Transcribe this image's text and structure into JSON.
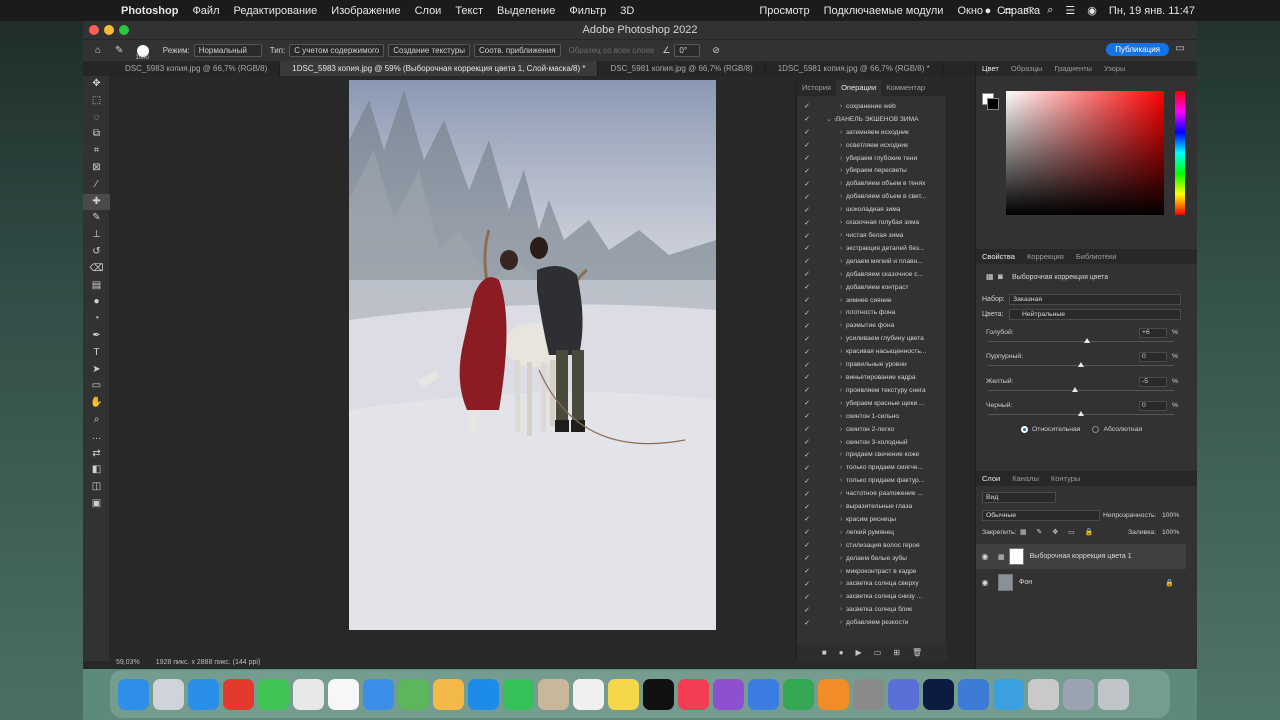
{
  "menubar": {
    "app": "Photoshop",
    "items": [
      "Файл",
      "Редактирование",
      "Изображение",
      "Слои",
      "Текст",
      "Выделение",
      "Фильтр",
      "3D",
      "Просмотр",
      "Подключаемые модули",
      "Окно",
      "Справка"
    ],
    "clock": "Пн, 19 янв. 11:47"
  },
  "window": {
    "title": "Adobe Photoshop 2022"
  },
  "options": {
    "brush_size": "1000",
    "mode_label": "Режим:",
    "mode_value": "Нормальный",
    "type_label": "Тип:",
    "type_btn1": "С учетом содержимого",
    "type_btn2": "Создание текстуры",
    "type_btn3": "Соотв. приближения",
    "sample_all": "Образец со всех слоев",
    "angle": "0°",
    "publish": "Публикация"
  },
  "tabs": [
    "DSC_5983 копия.jpg @ 66,7% (RGB/8)",
    "1DSC_5983 копия.jpg @ 59% (Выборочная коррекция цвета 1, Слой-маска/8) *",
    "DSC_5981 копия.jpg @ 66,7% (RGB/8)",
    "1DSC_5981 копия.jpg @ 66,7% (RGB/8) *"
  ],
  "status": {
    "zoom": "59,03%",
    "size": "1928 пикс. x 2888 пикс. (144 ppi)"
  },
  "ops_panel": {
    "tabs": [
      "История",
      "Операции",
      "Комментар"
    ],
    "items": [
      "сохранение web",
      "ПАНЕЛЬ ЭКШЕНОВ ЗИМА",
      "затемняем исходник",
      "осветляем исходник",
      "убираем глубокие тени",
      "убираем пересветы",
      "добавляем объем в тенях",
      "добавляем объем в свет...",
      "шоколадная зима",
      "сказочная голубая зима",
      "чистая белая зима",
      "экстракция деталей без...",
      "делаем мягкий и плавн...",
      "добавляем сказочное с...",
      "добавляем контраст",
      "зимнее сияние",
      "плотность фона",
      "размытие фона",
      "усиливаем глубину цвета",
      "красивая насыщенность...",
      "правильные уровни",
      "виньетирование кадра",
      "проявляем текстуру снега",
      "убираем красные щеки ...",
      "скинтон 1-сильно",
      "скинтон 2-легко",
      "скинтон 3-холодный",
      "придаем свечение коже",
      "только придаем смягче...",
      "только придаем фактур...",
      "частотное разложение ...",
      "выразительные глаза",
      "красим ресницы",
      "легкий румянец",
      "стилизация волос героя",
      "делаем белые зубы",
      "микроконтраст в кадре",
      "засветка солнца сверху",
      "засветка солнца снизу ...",
      "засветка солнца блик",
      "добавляем резкости"
    ]
  },
  "color_panel": {
    "tabs": [
      "Цвет",
      "Образцы",
      "Градиенты",
      "Узоры"
    ]
  },
  "properties": {
    "tabs": [
      "Свойства",
      "Коррекция",
      "Библиотеки"
    ],
    "title": "Выборочная коррекция цвета",
    "preset_label": "Набор:",
    "preset_value": "Заказная",
    "colors_label": "Цвета:",
    "colors_value": "Нейтральные",
    "sliders": [
      {
        "label": "Голубой:",
        "value": "+6",
        "pos": 0.53
      },
      {
        "label": "Пурпурный:",
        "value": "0",
        "pos": 0.5
      },
      {
        "label": "Желтый:",
        "value": "-5",
        "pos": 0.47
      },
      {
        "label": "Черный:",
        "value": "0",
        "pos": 0.5
      }
    ],
    "mode_relative": "Относительная",
    "mode_absolute": "Абсолютная"
  },
  "layers_panel": {
    "tabs": [
      "Слои",
      "Каналы",
      "Контуры"
    ],
    "filter": "Вид",
    "blend": "Обычные",
    "opacity_label": "Непрозрачность:",
    "opacity": "100%",
    "lock_label": "Закрепить:",
    "fill_label": "Заливка:",
    "fill": "100%",
    "layers": [
      "Выборочная коррекция цвета 1",
      "Фон"
    ]
  },
  "colors": {
    "accent": "#1473e6",
    "bg": "#282828",
    "panel": "#323232"
  }
}
